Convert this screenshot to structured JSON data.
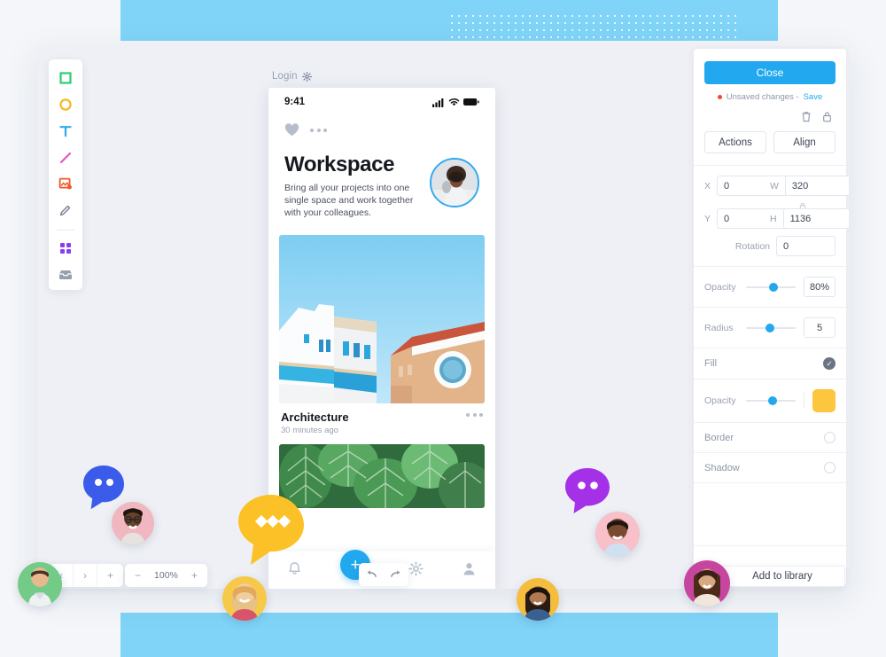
{
  "app": {
    "canvas_label": "Login",
    "canvas_settings_icon": "gear-icon"
  },
  "toolbar": {
    "tools": [
      {
        "name": "rectangle-tool",
        "icon": "square-icon",
        "color": "#2ecc71"
      },
      {
        "name": "ellipse-tool",
        "icon": "circle-icon",
        "color": "#f5b921"
      },
      {
        "name": "text-tool",
        "icon": "text-t-icon",
        "color": "#2ca9f0"
      },
      {
        "name": "line-tool",
        "icon": "diagonal-line-icon",
        "color": "#e255c8"
      },
      {
        "name": "image-tool",
        "icon": "image-icon",
        "color": "#f0562a"
      },
      {
        "name": "pencil-tool",
        "icon": "pencil-icon",
        "color": "#7b8496"
      },
      {
        "name": "components-tool",
        "icon": "grid-four-icon",
        "color": "#8b3df0"
      },
      {
        "name": "library-tool",
        "icon": "drawer-icon",
        "color": "#7b8496"
      }
    ]
  },
  "phone": {
    "status": {
      "time": "9:41",
      "signal_icon": "cellular-bars-icon",
      "wifi_icon": "wifi-icon",
      "battery_icon": "battery-full-icon"
    },
    "topbar": {
      "favorite_icon": "heart-icon",
      "more_icon": "more-dots-icon"
    },
    "hero": {
      "title": "Workspace",
      "subtitle": "Bring all your projects into one single space and work together with your colleagues.",
      "avatar": "user-avatar"
    },
    "card": {
      "title": "Architecture",
      "time": "30 minutes ago",
      "more_icon": "more-dots-icon",
      "image": "mediterranean-architecture-photo"
    },
    "card2": {
      "image": "green-leaves-photo"
    },
    "tabbar": [
      {
        "name": "tab-notifications",
        "icon": "bell-icon"
      },
      {
        "name": "tab-add",
        "icon": "plus-icon",
        "label": "+"
      },
      {
        "name": "tab-settings",
        "icon": "gear-icon"
      },
      {
        "name": "tab-profile",
        "icon": "person-icon"
      }
    ]
  },
  "panel": {
    "close_label": "Close",
    "unsaved_text": "Unsaved changes -",
    "save_label": "Save",
    "status_dot_color": "#f04a23",
    "tools": [
      {
        "name": "delete-icon",
        "label": "trash-icon"
      },
      {
        "name": "lock-icon",
        "label": "lock-icon"
      }
    ],
    "actions_label": "Actions",
    "align_label": "Align",
    "geometry": {
      "x_label": "X",
      "x_value": "0",
      "y_label": "Y",
      "y_value": "0",
      "w_label": "W",
      "w_value": "320",
      "h_label": "H",
      "h_value": "1136",
      "ratio_lock_icon": "lock-icon",
      "rotation_label": "Rotation",
      "rotation_value": "0"
    },
    "opacity": {
      "label": "Opacity",
      "value": "80%",
      "percent": 55
    },
    "radius": {
      "label": "Radius",
      "value": "5",
      "percent": 48
    },
    "fill": {
      "label": "Fill",
      "enabled": true
    },
    "fill_opacity": {
      "label": "Opacity",
      "percent": 53,
      "color": "#fcc63f"
    },
    "border": {
      "label": "Border",
      "enabled": false
    },
    "shadow": {
      "label": "Shadow",
      "enabled": false
    }
  },
  "bottom": {
    "page_prev": "‹",
    "page_next": "›",
    "page_add": "+",
    "zoom_out": "−",
    "zoom_value": "100%",
    "zoom_in": "+",
    "undo_icon": "undo-arrow-icon",
    "redo_icon": "redo-arrow-icon",
    "add_to_library_label": "Add to library"
  },
  "collaborators": [
    {
      "name": "avatar-green",
      "bg": "#74cb87"
    },
    {
      "name": "avatar-pink-1",
      "bg": "#f0b7c0"
    },
    {
      "name": "avatar-yellow-1",
      "bg": "#f7c948"
    },
    {
      "name": "avatar-yellow-2",
      "bg": "#f4bd3e"
    },
    {
      "name": "avatar-pink-2",
      "bg": "#f8c0c8"
    },
    {
      "name": "avatar-magenta",
      "bg": "#c6469f"
    }
  ],
  "bubbles": [
    {
      "name": "chat-bubble-blue",
      "color": "#3b5bea",
      "dots": 2
    },
    {
      "name": "chat-bubble-yellow",
      "color": "#fcc127",
      "dots": 3
    },
    {
      "name": "chat-bubble-purple",
      "color": "#a431e8",
      "dots": 2
    }
  ]
}
